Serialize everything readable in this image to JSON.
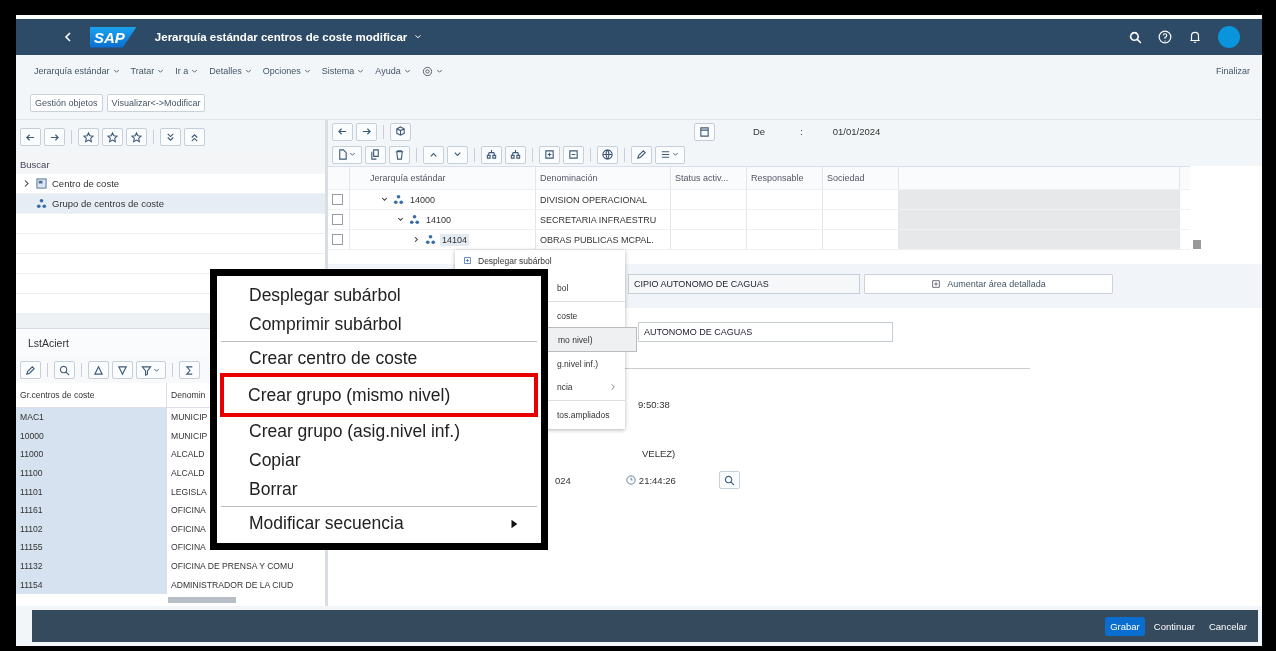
{
  "shell": {
    "logo": "SAP",
    "title": "Jerarquía estándar centros de coste modificar"
  },
  "menu_bar": {
    "menus": [
      "Jerarquía estándar",
      "Tratar",
      "Ir a",
      "Detalles",
      "Opciones",
      "Sistema",
      "Ayuda"
    ],
    "exit": "Finalizar"
  },
  "toolbar": {
    "buttons": [
      "Gestión objetos",
      "Visualizar<->Modificar"
    ]
  },
  "navigation": {
    "header": "Buscar",
    "items": [
      {
        "label": "Centro de coste",
        "kind": "center",
        "expandable": true,
        "selected": false
      },
      {
        "label": "Grupo de centros de coste",
        "kind": "group",
        "expandable": false,
        "selected": true
      }
    ]
  },
  "hit_list": {
    "title": "LstAciert",
    "columns": [
      "Gr.centros de coste",
      "Denomin"
    ],
    "rows": [
      [
        "MAC1",
        "MUNICIP"
      ],
      [
        "10000",
        "MUNICIP"
      ],
      [
        "11000",
        "ALCALD"
      ],
      [
        "11100",
        "ALCALD"
      ],
      [
        "11101",
        "LEGISLA"
      ],
      [
        "11161",
        "OFICINA"
      ],
      [
        "11102",
        "OFICINA"
      ],
      [
        "11155",
        "OFICINA"
      ],
      [
        "11132",
        "OFICINA DE PRENSA Y COMU"
      ],
      [
        "11154",
        "ADMINISTRADOR DE LA CIUD"
      ]
    ]
  },
  "hierarchy": {
    "date_label": "De",
    "date_separator": ":",
    "date": "01/01/2024",
    "columns": [
      "Jerarquía estándar",
      "Denominación",
      "Status activ...",
      "Responsable",
      "Sociedad"
    ],
    "rows": [
      {
        "node": "14000",
        "name": "DIVISION OPERACIONAL",
        "checked": false,
        "expanded": true,
        "selected": false,
        "children": [
          {
            "node": "14100",
            "name": "SECRETARIA INFRAESTRU",
            "checked": false,
            "expanded": true,
            "selected": false,
            "children": [
              {
                "node": "14104",
                "name": "OBRAS PUBLICAS MCPAL.",
                "checked": false,
                "expanded": false,
                "selected": true
              }
            ]
          }
        ]
      }
    ]
  },
  "context_menu": {
    "items": [
      {
        "kind": "icon_item",
        "label": "Desplegar subárbol",
        "selected": false
      },
      {
        "kind": "item",
        "label": "bol",
        "selected": false
      },
      {
        "kind": "separator"
      },
      {
        "kind": "item",
        "label": "coste",
        "selected": false
      },
      {
        "kind": "item",
        "label": "mo nivel)",
        "selected": true
      },
      {
        "kind": "item",
        "label": "g.nivel inf.)",
        "selected": false
      },
      {
        "kind": "submenu",
        "label": "ncia",
        "selected": false
      },
      {
        "kind": "separator"
      },
      {
        "kind": "item",
        "label": "tos.ampliados",
        "selected": false
      }
    ]
  },
  "detail": {
    "group_field": "CIPIO AUTONOMO DE CAGUAS",
    "expand_button": "Aumentar área detallada",
    "description_field": "AUTONOMO DE CAGUAS",
    "changed_time": "9:50:38",
    "changed_by": "VELEZ)",
    "created_date": "024",
    "created_time": "21:44:26"
  },
  "zoom_callout": {
    "items": [
      {
        "kind": "item",
        "label": "Desplegar subárbol",
        "selected": false
      },
      {
        "kind": "item",
        "label": "Comprimir subárbol",
        "selected": false
      },
      {
        "kind": "separator"
      },
      {
        "kind": "item",
        "label": "Crear centro de coste",
        "selected": false
      },
      {
        "kind": "item",
        "label": "Crear grupo (mismo nivel)",
        "selected": true
      },
      {
        "kind": "item",
        "label": "Crear grupo (asig.nivel inf.)",
        "selected": false
      },
      {
        "kind": "item",
        "label": "Copiar",
        "selected": false
      },
      {
        "kind": "item",
        "label": "Borrar",
        "selected": false
      },
      {
        "kind": "separator"
      },
      {
        "kind": "submenu",
        "label": "Modificar secuencia",
        "selected": false
      }
    ]
  },
  "footer": {
    "buttons": [
      {
        "label": "Grabar",
        "kind": "primary"
      },
      {
        "label": "Continuar",
        "kind": "plain"
      },
      {
        "label": "Cancelar",
        "kind": "plain"
      }
    ]
  }
}
